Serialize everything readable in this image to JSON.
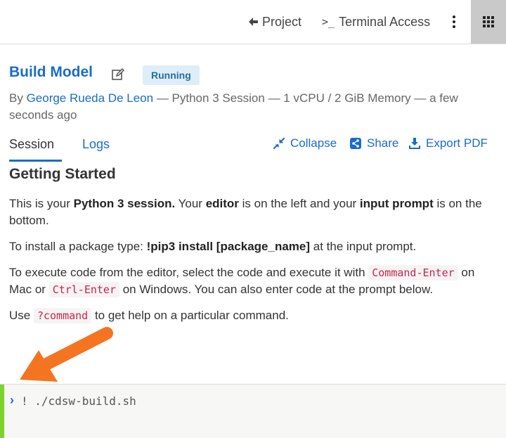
{
  "topbar": {
    "project_label": "Project",
    "terminal_label": "Terminal Access"
  },
  "header": {
    "title": "Build Model",
    "status": "Running",
    "meta_prefix": "By ",
    "author": "George Rueda De Leon",
    "meta_rest": " — Python 3 Session — 1 vCPU / 2 GiB Memory — a few seconds ago"
  },
  "tabs": [
    {
      "label": "Session",
      "active": true
    },
    {
      "label": "Logs",
      "active": false
    }
  ],
  "actions": {
    "collapse": "Collapse",
    "share": "Share",
    "export": "Export PDF"
  },
  "content": {
    "heading": "Getting Started",
    "p1": {
      "a": "This is your ",
      "b1": "Python 3 session.",
      "c": " Your ",
      "b2": "editor",
      "d": " is on the left and your ",
      "b3": "input prompt",
      "e": " is on the bottom."
    },
    "p2": {
      "a": "To install a package type: ",
      "b": "!pip3 install [package_name]",
      "c": " at the input prompt."
    },
    "p3": {
      "a": "To execute code from the editor, select the code and execute it with ",
      "code1": "Command-Enter",
      "b": " on Mac or ",
      "code2": "Ctrl-Enter",
      "c": " on Windows. You can also enter code at the prompt below."
    },
    "p4": {
      "a": "Use ",
      "code": "?command",
      "b": " to get help on a particular command."
    }
  },
  "prompt": {
    "value": "! ./cdsw-build.sh"
  },
  "colors": {
    "link": "#1a6cc9",
    "badge_bg": "#ddeef9",
    "prompt_bar": "#7cd32a",
    "arrow": "#f47421",
    "code_text": "#c7254e"
  }
}
